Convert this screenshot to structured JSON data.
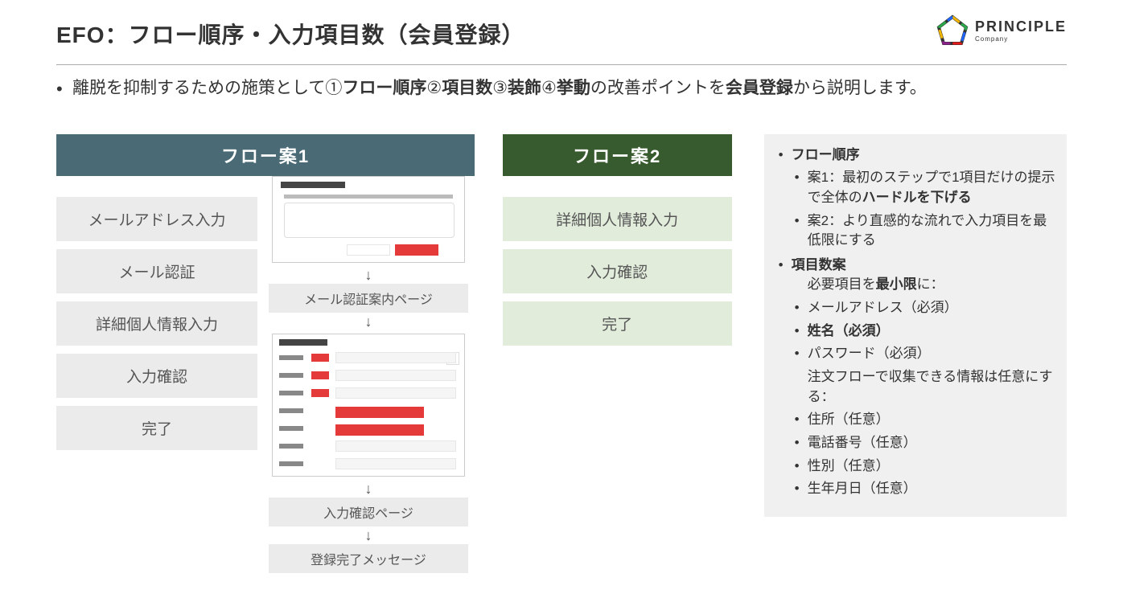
{
  "title": "EFO：フロー順序・入力項目数（会員登録）",
  "logo": {
    "brand": "PRINCIPLE",
    "sub": "Company"
  },
  "lead": {
    "pre": "離脱を抑制するための施策として①",
    "b1": "フロー順序",
    "mid1": "②",
    "b2": "項目数",
    "mid2": "③",
    "b3": "装飾",
    "mid3": "④",
    "b4": "挙動",
    "mid4": "の改善ポイントを",
    "b5": "会員登録",
    "post": "から説明します。"
  },
  "flow1": {
    "header": "フロー案1",
    "steps": [
      "メールアドレス入力",
      "メール認証",
      "詳細個人情報入力",
      "入力確認",
      "完了"
    ],
    "sub_steps": [
      "メール認証案内ページ",
      "入力確認ページ",
      "登録完了メッセージ"
    ]
  },
  "flow2": {
    "header": "フロー案2",
    "steps": [
      "詳細個人情報入力",
      "入力確認",
      "完了"
    ]
  },
  "notes": {
    "h1": "フロー順序",
    "h1a_pre": "案1：最初のステップで1項目だけの提示で全体の",
    "h1a_b": "ハードルを下げる",
    "h1b": "案2：より直感的な流れで入力項目を最低限にする",
    "h2": "項目数案",
    "h2_intro_pre": "必要項目を",
    "h2_intro_b": "最小限",
    "h2_intro_post": "に：",
    "req": [
      "メールアドレス（必須）",
      "姓名（必須）",
      "パスワード（必須）"
    ],
    "opt_intro": "注文フローで収集できる情報は任意にする：",
    "opt": [
      "住所（任意）",
      "電話番号（任意）",
      "性別（任意）",
      "生年月日（任意）"
    ]
  }
}
